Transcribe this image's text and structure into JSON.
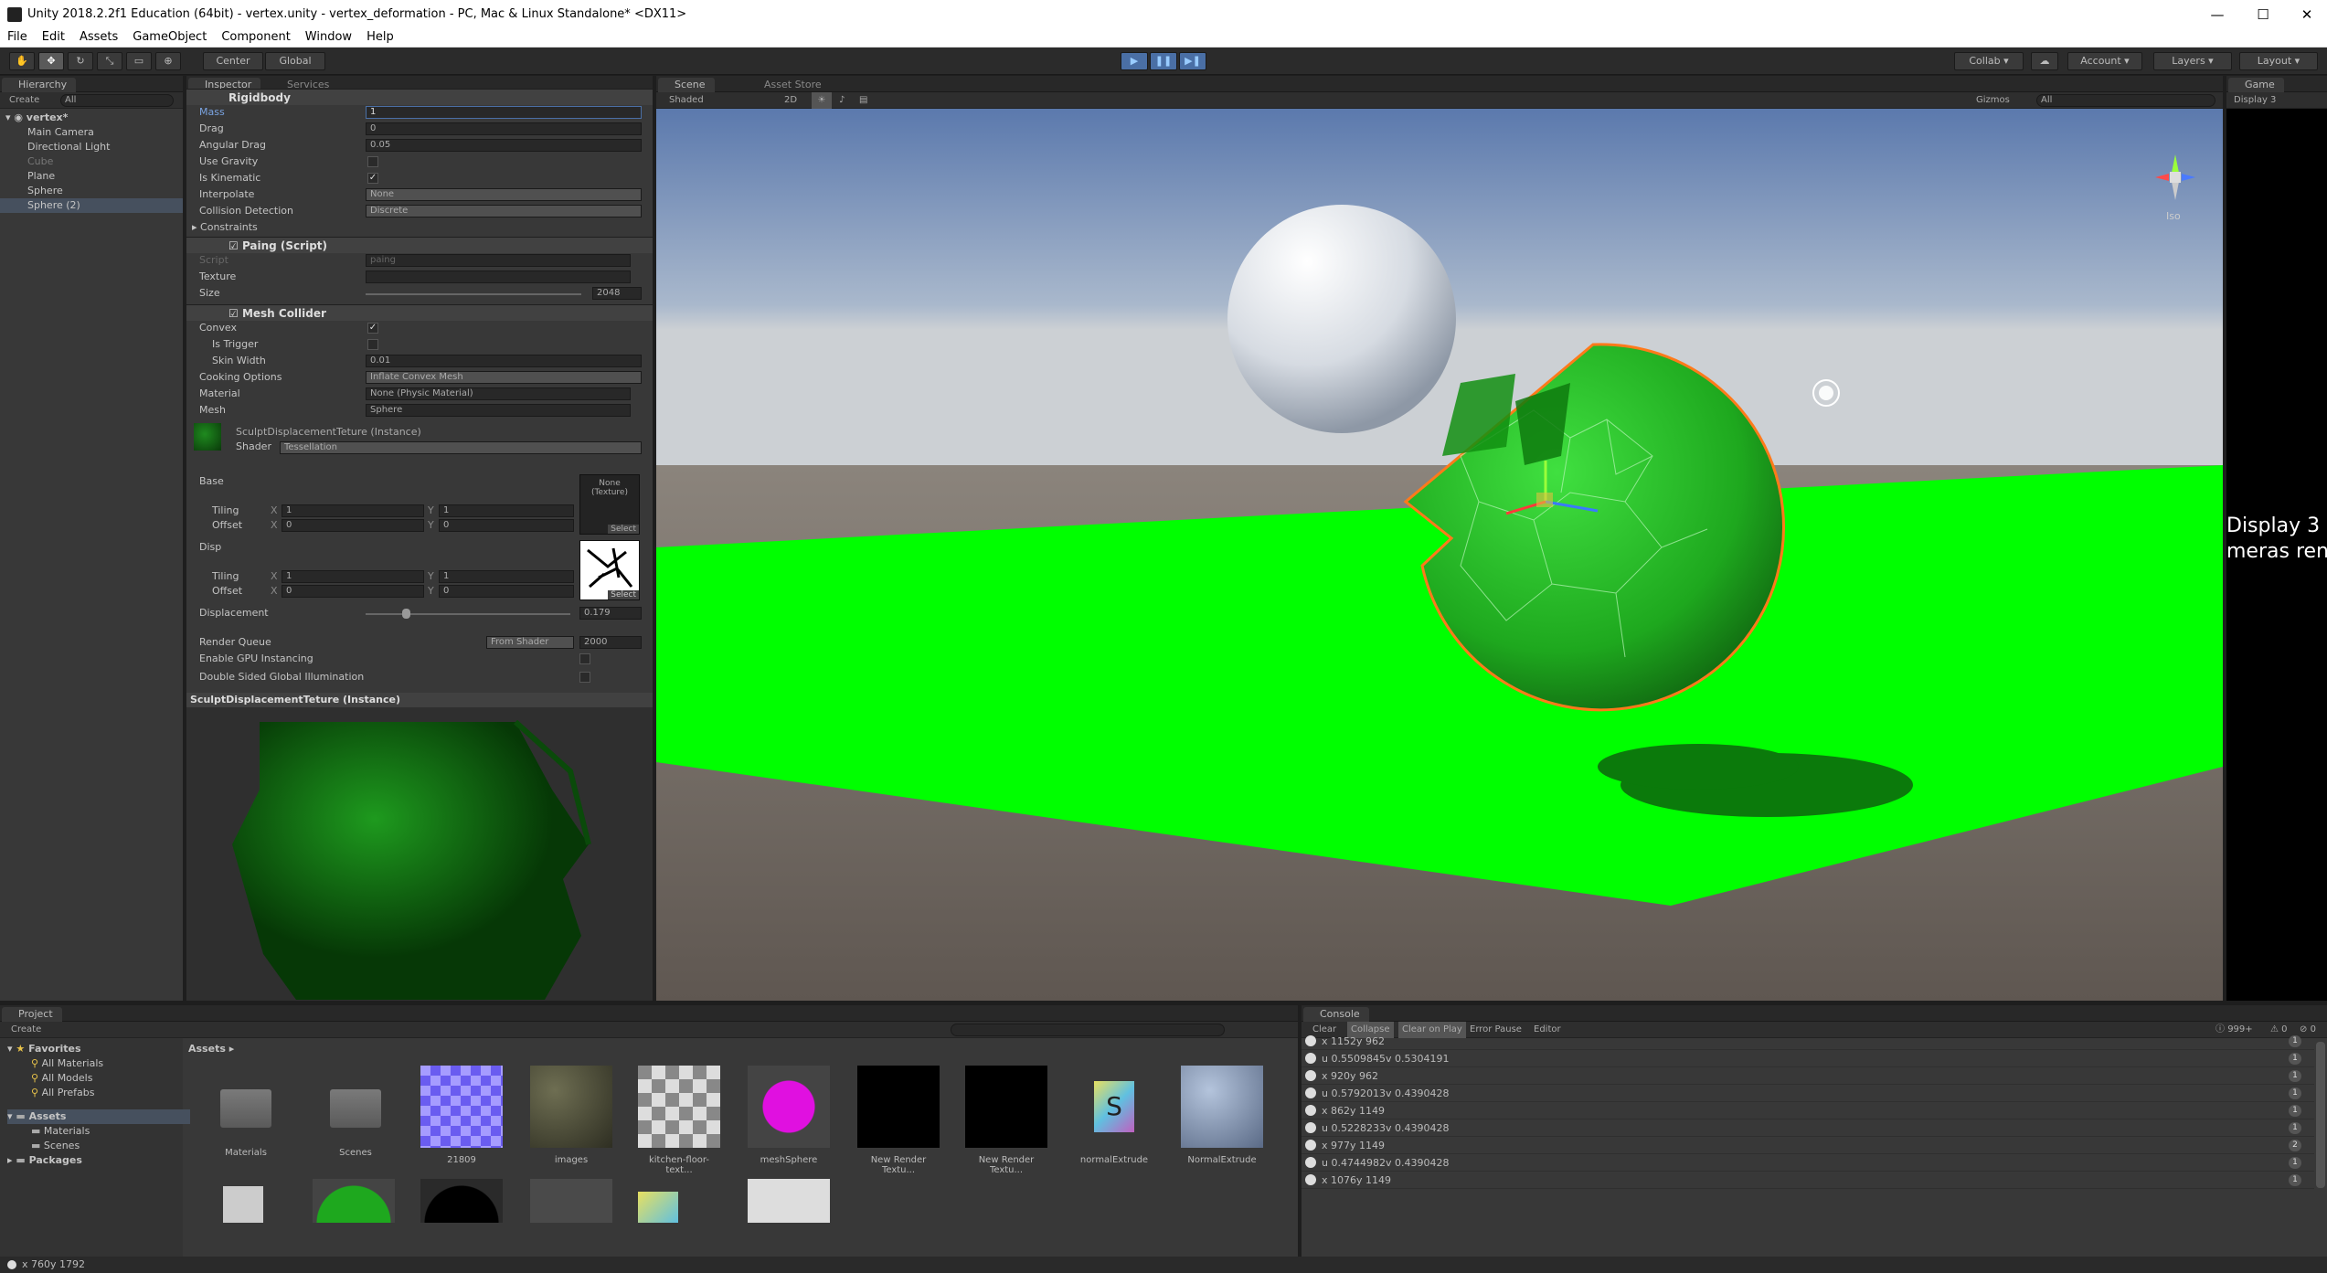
{
  "window": {
    "title": "Unity 2018.2.2f1 Education (64bit) - vertex.unity - vertex_deformation - PC, Mac & Linux Standalone* <DX11>",
    "min": "—",
    "max": "☐",
    "close": "✕"
  },
  "menu": [
    "File",
    "Edit",
    "Assets",
    "GameObject",
    "Component",
    "Window",
    "Help"
  ],
  "toolbar": {
    "center": "Center",
    "global": "Global",
    "collab": "Collab",
    "account": "Account",
    "layers": "Layers",
    "layout": "Layout"
  },
  "hierarchy": {
    "tab": "Hierarchy",
    "create": "Create",
    "search": "All",
    "scene": "vertex*",
    "items": [
      "Main Camera",
      "Directional Light",
      "Cube",
      "Plane",
      "Sphere",
      "Sphere (2)"
    ]
  },
  "inspector": {
    "tab": "Inspector",
    "tab2": "Services",
    "rigidbody": {
      "title": "Rigidbody",
      "mass_label": "Mass",
      "mass": "1",
      "drag_label": "Drag",
      "drag": "0",
      "angular_label": "Angular Drag",
      "angular": "0.05",
      "gravity_label": "Use Gravity",
      "kinematic_label": "Is Kinematic",
      "interpolate_label": "Interpolate",
      "interpolate": "None",
      "collision_label": "Collision Detection",
      "collision": "Discrete",
      "constraints_label": "Constraints"
    },
    "paing": {
      "title": "Paing (Script)",
      "script_label": "Script",
      "script": "paing",
      "texture_label": "Texture",
      "size_label": "Size",
      "size": "2048"
    },
    "meshcollider": {
      "title": "Mesh Collider",
      "convex_label": "Convex",
      "trigger_label": "Is Trigger",
      "skin_label": "Skin Width",
      "skin": "0.01",
      "cooking_label": "Cooking Options",
      "cooking": "Inflate Convex Mesh",
      "material_label": "Material",
      "material": "None (Physic Material)",
      "mesh_label": "Mesh",
      "mesh": "Sphere"
    },
    "material": {
      "title": "SculptDisplacementTeture (Instance)",
      "shader_label": "Shader",
      "shader": "Tessellation",
      "base_label": "Base",
      "base_none": "None (Texture)",
      "select": "Select",
      "tiling_label": "Tiling",
      "offset_label": "Offset",
      "x": "X",
      "y": "Y",
      "base_tiling_x": "1",
      "base_tiling_y": "1",
      "base_offset_x": "0",
      "base_offset_y": "0",
      "disp_label": "Disp",
      "disp_tiling_x": "1",
      "disp_tiling_y": "1",
      "disp_offset_x": "0",
      "disp_offset_y": "0",
      "displacement_label": "Displacement",
      "displacement": "0.179",
      "renderqueue_label": "Render Queue",
      "renderqueue_mode": "From Shader",
      "renderqueue": "2000",
      "gpu_label": "Enable GPU Instancing",
      "dsgi_label": "Double Sided Global Illumination"
    },
    "preview_title": "SculptDisplacementTeture (Instance)"
  },
  "scene": {
    "tab": "Scene",
    "tab2": "Asset Store",
    "shading": "Shaded",
    "mode2d": "2D",
    "gizmos": "Gizmos",
    "search": "All",
    "iso": "Iso"
  },
  "game": {
    "tab": "Game",
    "display": "Display 3",
    "line1": "Display 3",
    "line2": "meras rend"
  },
  "project": {
    "tab": "Project",
    "create": "Create",
    "favorites": "Favorites",
    "fav_items": [
      "All Materials",
      "All Models",
      "All Prefabs"
    ],
    "assets": "Assets",
    "asset_folders": [
      "Materials",
      "Scenes"
    ],
    "packages": "Packages",
    "breadcrumb": "Assets",
    "thumbs": [
      "Materials",
      "Scenes",
      "21809",
      "images",
      "kitchen-floor-text...",
      "meshSphere",
      "New Render Textu...",
      "New Render Textu...",
      "normalExtrude",
      "NormalExtrude"
    ]
  },
  "console": {
    "tab": "Console",
    "buttons": [
      "Clear",
      "Collapse",
      "Clear on Play",
      "Error Pause",
      "Editor"
    ],
    "count": "999+",
    "warn": "0",
    "err": "0",
    "lines": [
      {
        "text": "x 1152y 962",
        "n": "1"
      },
      {
        "text": "u 0.5509845v 0.5304191",
        "n": "1"
      },
      {
        "text": "x 920y 962",
        "n": "1"
      },
      {
        "text": "u 0.5792013v 0.4390428",
        "n": "1"
      },
      {
        "text": "x 862y 1149",
        "n": "1"
      },
      {
        "text": "u 0.5228233v 0.4390428",
        "n": "1"
      },
      {
        "text": "x 977y 1149",
        "n": "2"
      },
      {
        "text": "u 0.4744982v 0.4390428",
        "n": "1"
      },
      {
        "text": "x 1076y 1149",
        "n": "1"
      }
    ]
  },
  "statusbar": "x 760y 1792",
  "colors": {
    "accent": "#4a6fa5",
    "selection": "#3e5f96",
    "green": "#00ff00"
  }
}
